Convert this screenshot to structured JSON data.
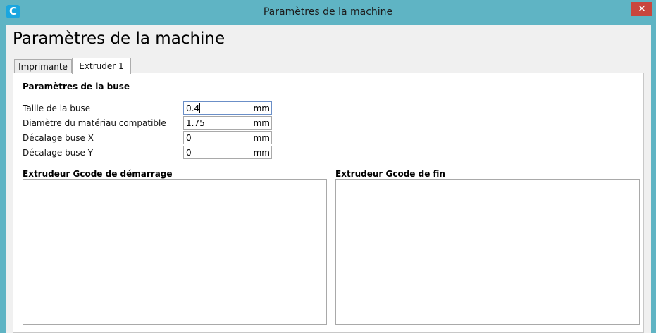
{
  "window": {
    "title": "Paramètres de la machine",
    "app_icon_glyph": "C",
    "close_glyph": "✕"
  },
  "heading": "Paramètres de la machine",
  "tabs": [
    {
      "label": "Imprimante",
      "active": false
    },
    {
      "label": "Extruder 1",
      "active": true
    }
  ],
  "nozzle_section": {
    "title": "Paramètres de la buse",
    "fields": [
      {
        "label": "Taille de la buse",
        "value": "0.4",
        "unit": "mm"
      },
      {
        "label": "Diamètre du matériau compatible",
        "value": "1.75",
        "unit": "mm"
      },
      {
        "label": "Décalage buse X",
        "value": "0",
        "unit": "mm"
      },
      {
        "label": "Décalage buse Y",
        "value": "0",
        "unit": "mm"
      }
    ]
  },
  "start_gcode": {
    "title": "Extrudeur Gcode de démarrage",
    "value": ""
  },
  "end_gcode": {
    "title": "Extrudeur Gcode de fin",
    "value": ""
  },
  "colors": {
    "titlebar": "#5fb4c4",
    "close": "#c9463d",
    "app_icon": "#1aa6df"
  }
}
